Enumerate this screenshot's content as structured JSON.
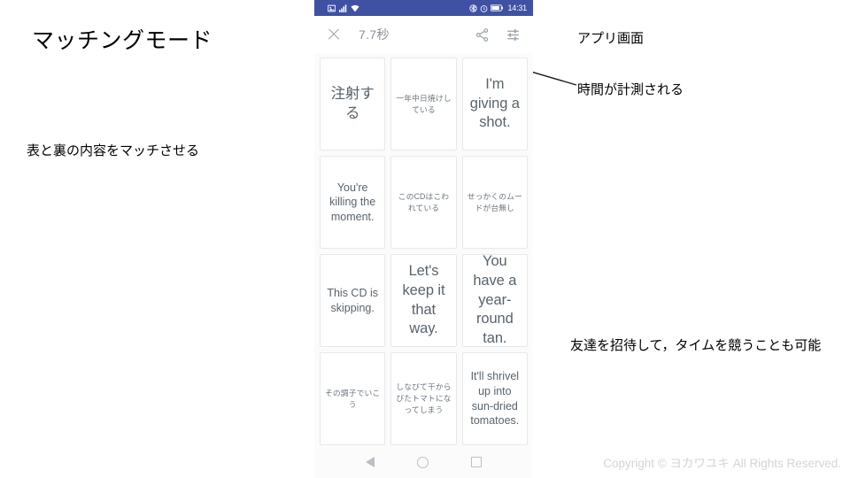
{
  "slide": {
    "title": "マッチングモード",
    "note_left": "表と裏の内容をマッチさせる",
    "note_app": "アプリ画面",
    "note_timer": "時間が計測される",
    "note_invite": "友達を招待して，タイムを競うことも可能",
    "footer": "Copyright © ヨカワユキ All Rights Reserved."
  },
  "phone": {
    "statusbar": {
      "clock": "14:31",
      "left_icons": [
        "photo-icon",
        "signal-icon",
        "wifi-icon"
      ],
      "right_icons": [
        "bluetooth-icon",
        "alarm-icon",
        "battery-icon"
      ],
      "background": "#3f51a3"
    },
    "toolbar": {
      "close_icon": "close-icon",
      "timer": "7.7秒",
      "share_icon": "share-icon",
      "tune_icon": "tune-icon"
    },
    "grid": {
      "cards": [
        {
          "text": "注射する",
          "size": "lg"
        },
        {
          "text": "一年中日焼けしている",
          "size": "sm"
        },
        {
          "text": "I'm giving a shot.",
          "size": "lg"
        },
        {
          "text": "You're killing the moment.",
          "size": "md"
        },
        {
          "text": "このCDはこわれている",
          "size": "sm"
        },
        {
          "text": "せっかくのムードが台無し",
          "size": "sm"
        },
        {
          "text": "This CD is skipping.",
          "size": "md"
        },
        {
          "text": "Let's keep it that way.",
          "size": "lg"
        },
        {
          "text": "You have a year-round tan.",
          "size": "lg"
        },
        {
          "text": "その調子でいこう",
          "size": "sm"
        },
        {
          "text": "しなびて干からびたトマトになってしまう",
          "size": "sm"
        },
        {
          "text": "It'll shrivel up into sun-dried tomatoes.",
          "size": "md"
        }
      ]
    },
    "navbar": {
      "back": "back-icon",
      "home": "home-icon",
      "recents": "recents-icon"
    }
  }
}
